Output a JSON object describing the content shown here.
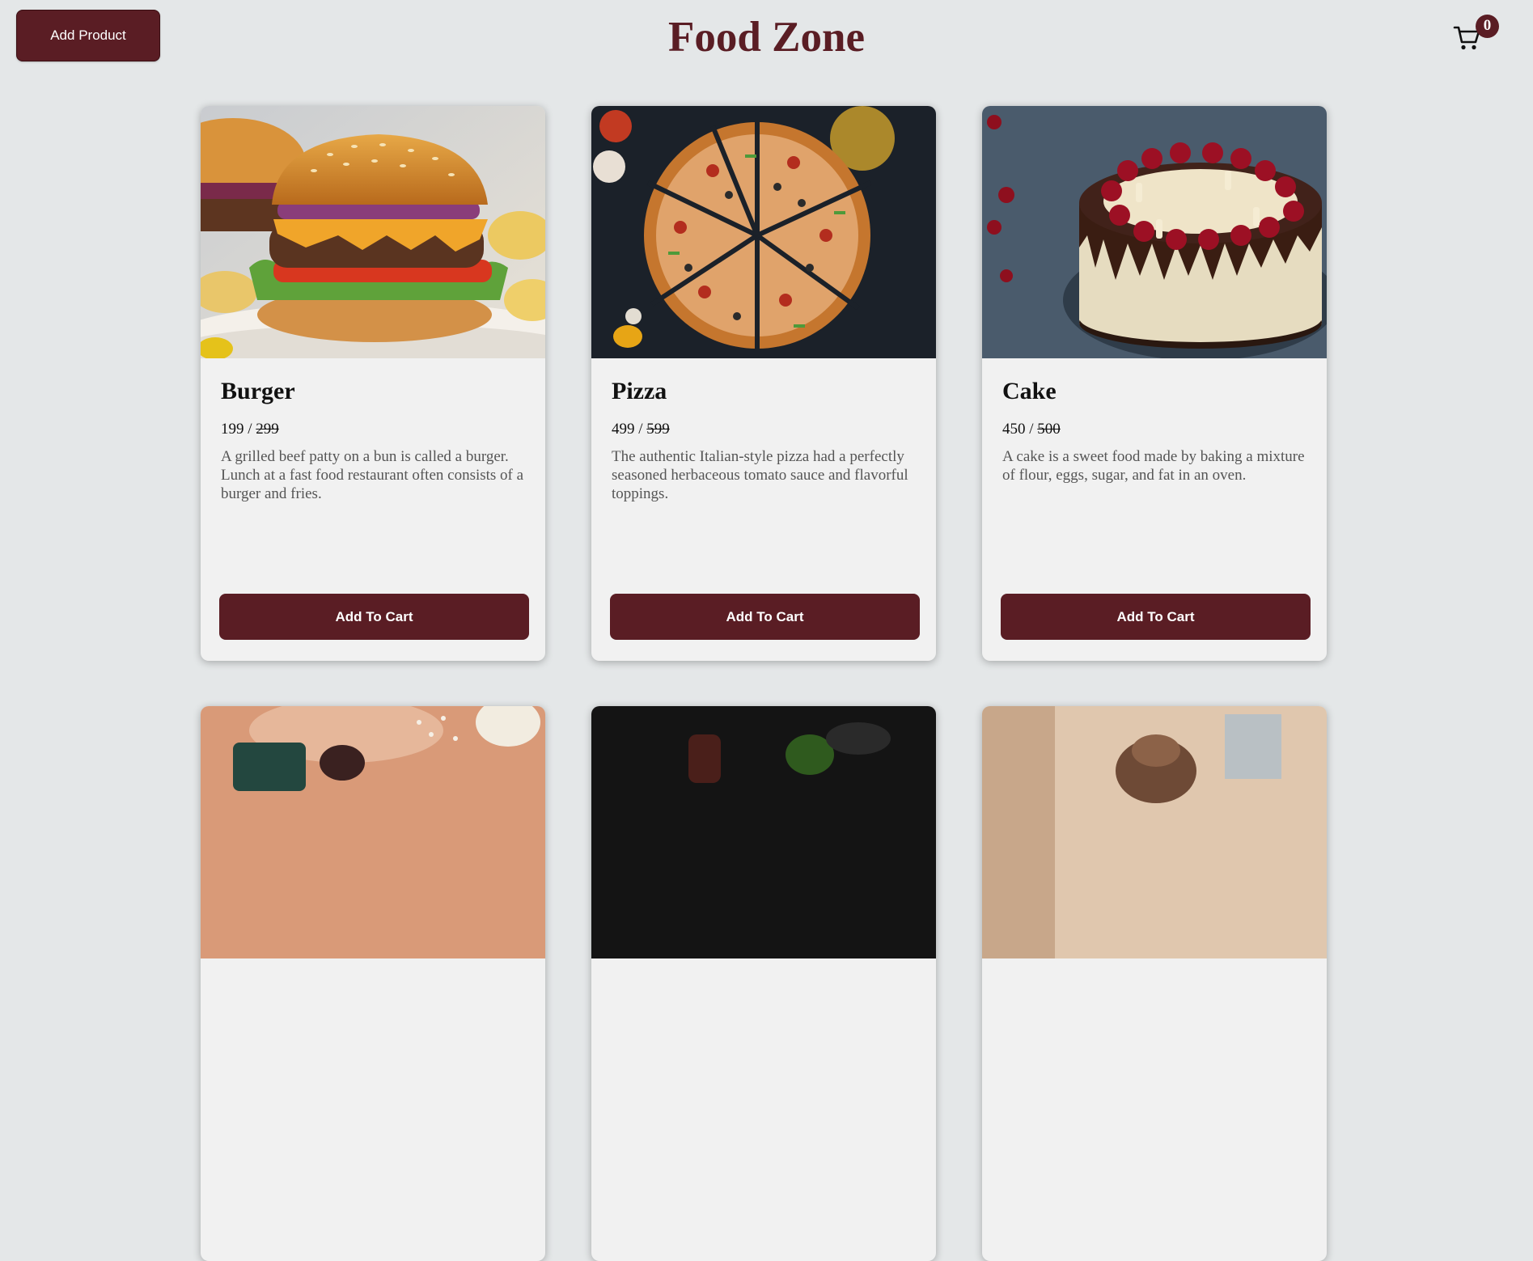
{
  "header": {
    "add_product_label": "Add Product",
    "brand_title": "Food Zone",
    "cart_icon": "shopping-cart-icon",
    "cart_count": "0"
  },
  "products": [
    {
      "name": "Burger",
      "price": "199",
      "separator": " / ",
      "old_price": "299",
      "description": "A grilled beef patty on a bun is called a burger. Lunch at a fast food restaurant often consists of a burger and fries.",
      "button_label": "Add To Cart"
    },
    {
      "name": "Pizza",
      "price": "499",
      "separator": " / ",
      "old_price": "599",
      "description": "The authentic Italian-style pizza had a perfectly seasoned herbaceous tomato sauce and flavorful toppings.",
      "button_label": "Add To Cart"
    },
    {
      "name": "Cake",
      "price": "450",
      "separator": " / ",
      "old_price": "500",
      "description": "A cake is a sweet food made by baking a mixture of flour, eggs, sugar, and fat in an oven.",
      "button_label": "Add To Cart"
    }
  ],
  "colors": {
    "accent": "#5a1d24",
    "background": "#e4e7e8",
    "card": "#f1f1f1"
  }
}
